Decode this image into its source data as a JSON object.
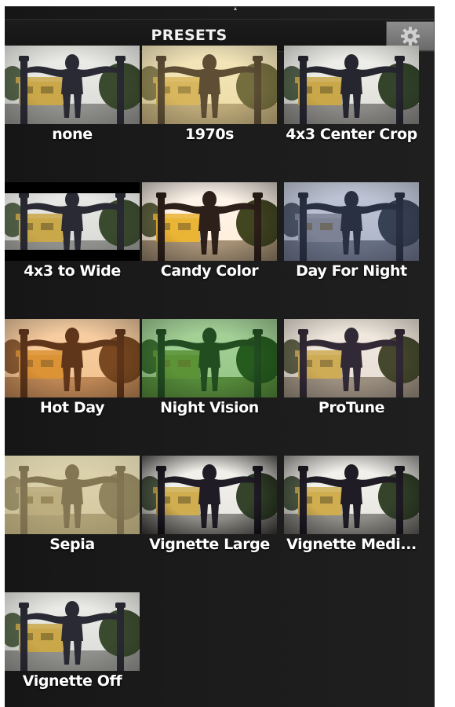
{
  "header": {
    "title": "PRESETS",
    "settings_icon": "gear-icon"
  },
  "presets": [
    {
      "label": "none",
      "filter": "none"
    },
    {
      "label": "1970s",
      "filter": "seventies"
    },
    {
      "label": "4x3 Center Crop",
      "filter": "crop"
    },
    {
      "label": "4x3 to Wide",
      "filter": "wide"
    },
    {
      "label": "Candy Color",
      "filter": "candy"
    },
    {
      "label": "Day For Night",
      "filter": "night"
    },
    {
      "label": "Hot Day",
      "filter": "hot"
    },
    {
      "label": "Night Vision",
      "filter": "green"
    },
    {
      "label": "ProTune",
      "filter": "protune"
    },
    {
      "label": "Sepia",
      "filter": "sepia"
    },
    {
      "label": "Vignette Large",
      "filter": "vignette-large"
    },
    {
      "label": "Vignette Medi...",
      "filter": "vignette-medium"
    },
    {
      "label": "Vignette Off",
      "filter": "none"
    }
  ],
  "colors": {
    "panel_background": "#1b1b1b",
    "header_text": "#f2f2f2",
    "label_text": "#ffffff",
    "gear_button": "#7c7c7c"
  }
}
